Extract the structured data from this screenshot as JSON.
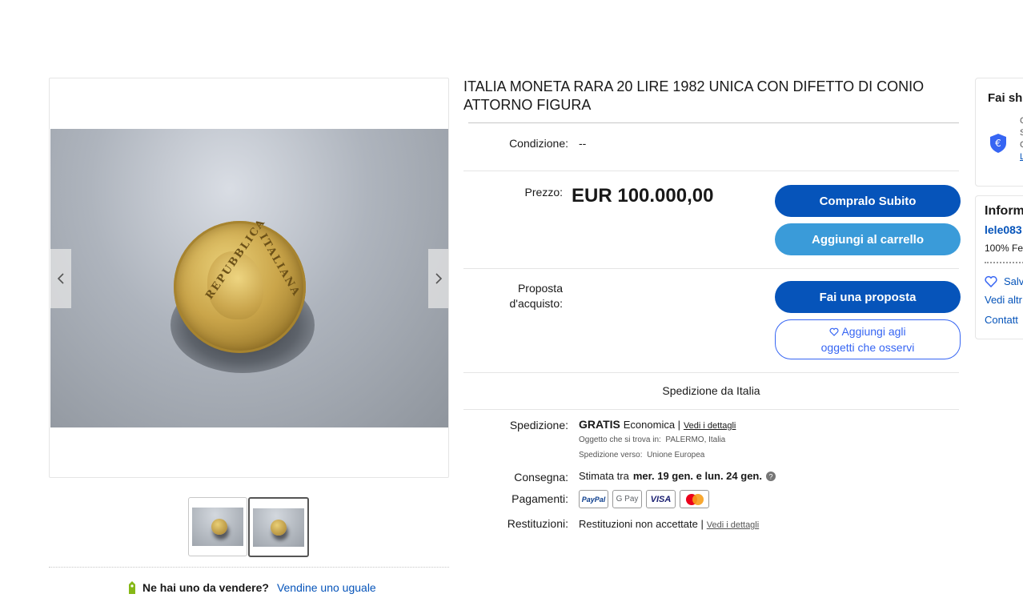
{
  "listing": {
    "title": "ITALIA MONETA RARA 20 LIRE 1982 UNICA CON DIFETTO DI CONIO ATTORNO FIGURA"
  },
  "gallery": {
    "coin_text_left": "REPUBBLICA",
    "coin_text_right": "ITALIANA",
    "thumbnail_count": 2,
    "selected_thumbnail": 2
  },
  "sell_promo": {
    "question": "Ne hai uno da vendere?",
    "link": "Vendine uno uguale"
  },
  "condition": {
    "label": "Condizione:",
    "value": "--"
  },
  "price": {
    "label": "Prezzo:",
    "value": "EUR 100.000,00",
    "buy_now": "Compralo Subito",
    "add_to_cart": "Aggiungi al carrello"
  },
  "offer": {
    "label_line1": "Proposta",
    "label_line2": "d'acquisto:",
    "make_offer": "Fai una proposta",
    "watch_line1": "Aggiungi agli",
    "watch_line2": "oggetti che osservi"
  },
  "shipping_from": "Spedizione da Italia",
  "shipping": {
    "label": "Spedizione:",
    "free": "GRATIS",
    "method": "Economica |",
    "details_link": "Vedi i dettagli",
    "location_label": "Oggetto che si trova in:",
    "location": "PALERMO, Italia",
    "ships_to_label": "Spedizione verso:",
    "ships_to": "Unione Europea"
  },
  "delivery": {
    "label": "Consegna:",
    "prefix": "Stimata tra",
    "range": "mer. 19 gen. e lun. 24 gen."
  },
  "payments": {
    "label": "Pagamenti:",
    "methods": [
      "PayPal",
      "G Pay",
      "VISA",
      "Mastercard"
    ]
  },
  "returns": {
    "label": "Restituzioni:",
    "value": "Restituzioni non accettate |",
    "details_link": "Vedi i dettagli"
  },
  "sidebar": {
    "shop_title": "Fai sh",
    "info_title": "Inform",
    "seller": "lele083",
    "feedback": "100% Fe",
    "save": "Salv",
    "see_other": "Vedi altr",
    "contact": "Contatt",
    "letter_1": "C",
    "letter_2": "S",
    "letter_3": "C",
    "letter_4": "L"
  },
  "colors": {
    "primary": "#0654ba",
    "secondary": "#3a9bd9",
    "outline": "#3665f3"
  }
}
